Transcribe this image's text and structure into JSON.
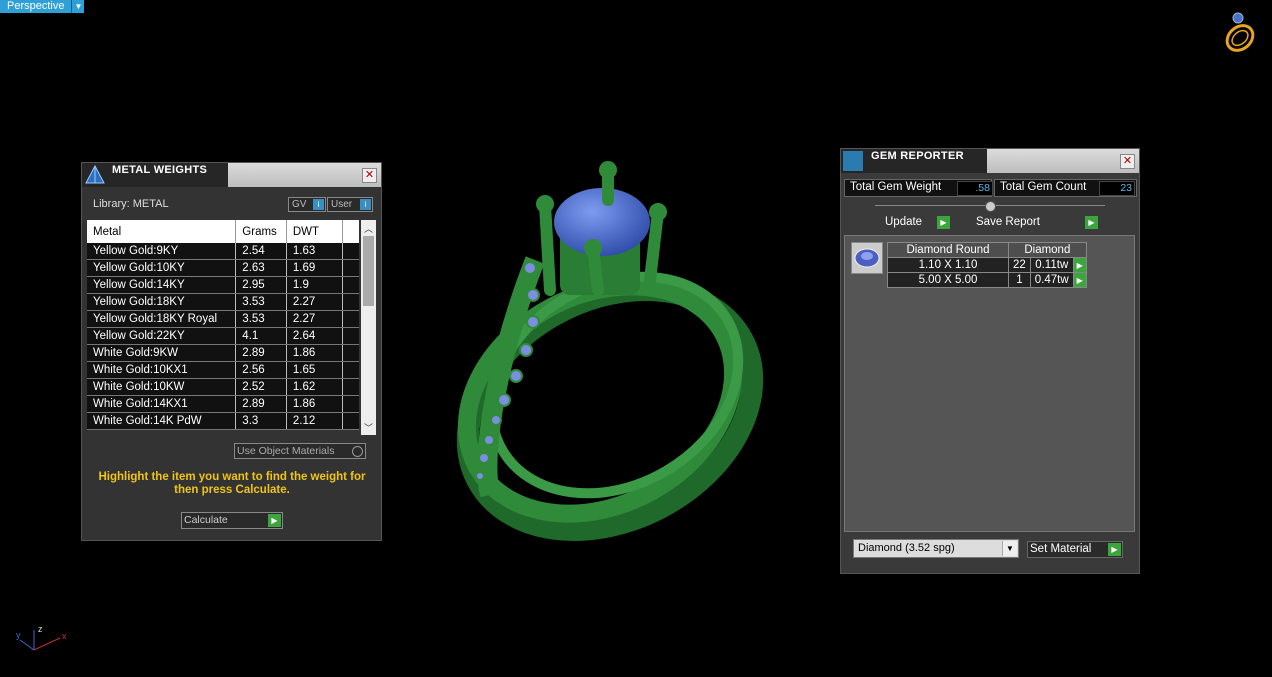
{
  "viewport": {
    "label": "Perspective"
  },
  "metal_weights": {
    "title": "METAL WEIGHTS",
    "library_label": "Library: METAL",
    "gv_label": "GV",
    "user_label": "User",
    "columns": [
      "Metal",
      "Grams",
      "DWT"
    ],
    "rows": [
      [
        "Yellow Gold:9KY",
        "2.54",
        "1.63"
      ],
      [
        "Yellow Gold:10KY",
        "2.63",
        "1.69"
      ],
      [
        "Yellow Gold:14KY",
        "2.95",
        "1.9"
      ],
      [
        "Yellow Gold:18KY",
        "3.53",
        "2.27"
      ],
      [
        "Yellow Gold:18KY Royal",
        "3.53",
        "2.27"
      ],
      [
        "Yellow Gold:22KY",
        "4.1",
        "2.64"
      ],
      [
        "White Gold:9KW",
        "2.89",
        "1.86"
      ],
      [
        "White Gold:10KX1",
        "2.56",
        "1.65"
      ],
      [
        "White Gold:10KW",
        "2.52",
        "1.62"
      ],
      [
        "White Gold:14KX1",
        "2.89",
        "1.86"
      ],
      [
        "White Gold:14K PdW",
        "3.3",
        "2.12"
      ]
    ],
    "use_object_materials": "Use Object Materials",
    "hint": "Highlight the item you want to find the weight for then press Calculate.",
    "calculate_label": "Calculate"
  },
  "gem_reporter": {
    "title": "GEM REPORTER",
    "total_gem_weight_label": "Total Gem Weight",
    "total_gem_weight": ".58",
    "total_gem_count_label": "Total Gem Count",
    "total_gem_count": "23",
    "update_label": "Update",
    "save_report_label": "Save Report",
    "headers": [
      "Diamond Round",
      "Diamond"
    ],
    "rows": [
      {
        "size": "1.10 X 1.10",
        "count": "22",
        "weight": "0.11tw"
      },
      {
        "size": "5.00 X 5.00",
        "count": "1",
        "weight": "0.47tw"
      }
    ],
    "material_select": "Diamond     (3.52 spg)",
    "set_material_label": "Set Material"
  },
  "colors": {
    "ring_green": "#2f8a3a",
    "gem_blue": "#4a6fd0",
    "accent_blue": "#2f9fd8",
    "go_green": "#3da53d",
    "hint_yellow": "#f0c419"
  },
  "icons": [
    "chevron-down-icon",
    "nav-ring-icon",
    "axis-triad-icon",
    "metal-weights-icon",
    "gem-reporter-icon",
    "close-icon",
    "play-arrow-icon"
  ]
}
